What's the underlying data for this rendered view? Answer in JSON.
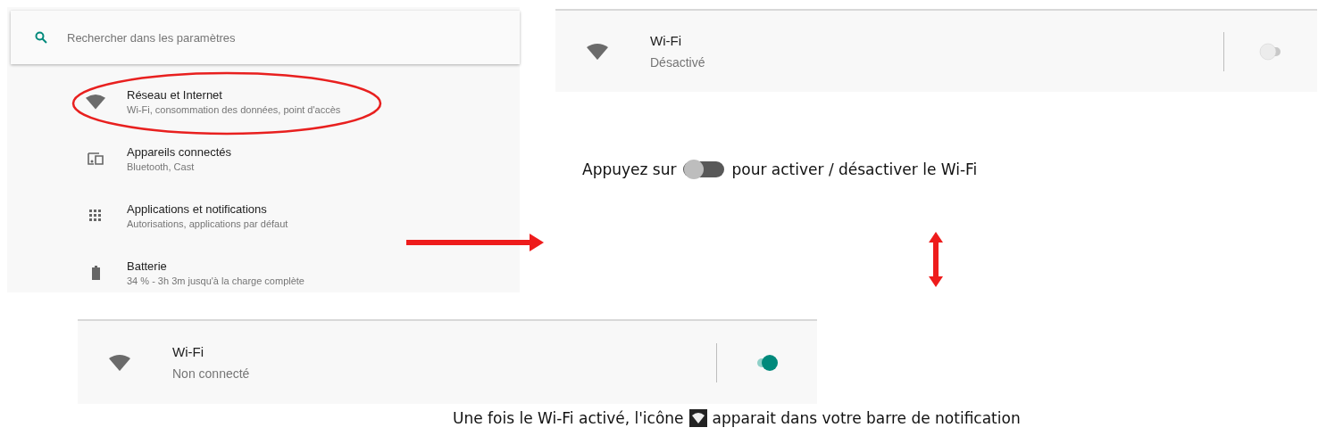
{
  "settings": {
    "search": {
      "placeholder": "Rechercher dans les paramètres"
    },
    "items": [
      {
        "kind": "wifi",
        "title": "Réseau et Internet",
        "subtitle": "Wi-Fi, consommation des données, point d'accès",
        "highlighted": true
      },
      {
        "kind": "devices",
        "title": "Appareils connectés",
        "subtitle": "Bluetooth, Cast",
        "highlighted": false
      },
      {
        "kind": "apps",
        "title": "Applications et notifications",
        "subtitle": "Autorisations, applications par défaut",
        "highlighted": false
      },
      {
        "kind": "battery",
        "title": "Batterie",
        "subtitle": "34 % - 3h 3m jusqu'à la charge complète",
        "highlighted": false
      }
    ]
  },
  "wifi_off": {
    "title": "Wi-Fi",
    "subtitle": "Désactivé",
    "on": false
  },
  "toggle_caption": {
    "before": "Appuyez sur",
    "after": "pour activer / désactiver le Wi-Fi"
  },
  "wifi_on": {
    "title": "Wi-Fi",
    "subtitle": "Non connecté",
    "on": true
  },
  "icon_caption": {
    "before": "Une fois le Wi-Fi activé, l'icône",
    "after": "apparait dans votre barre de notification"
  }
}
